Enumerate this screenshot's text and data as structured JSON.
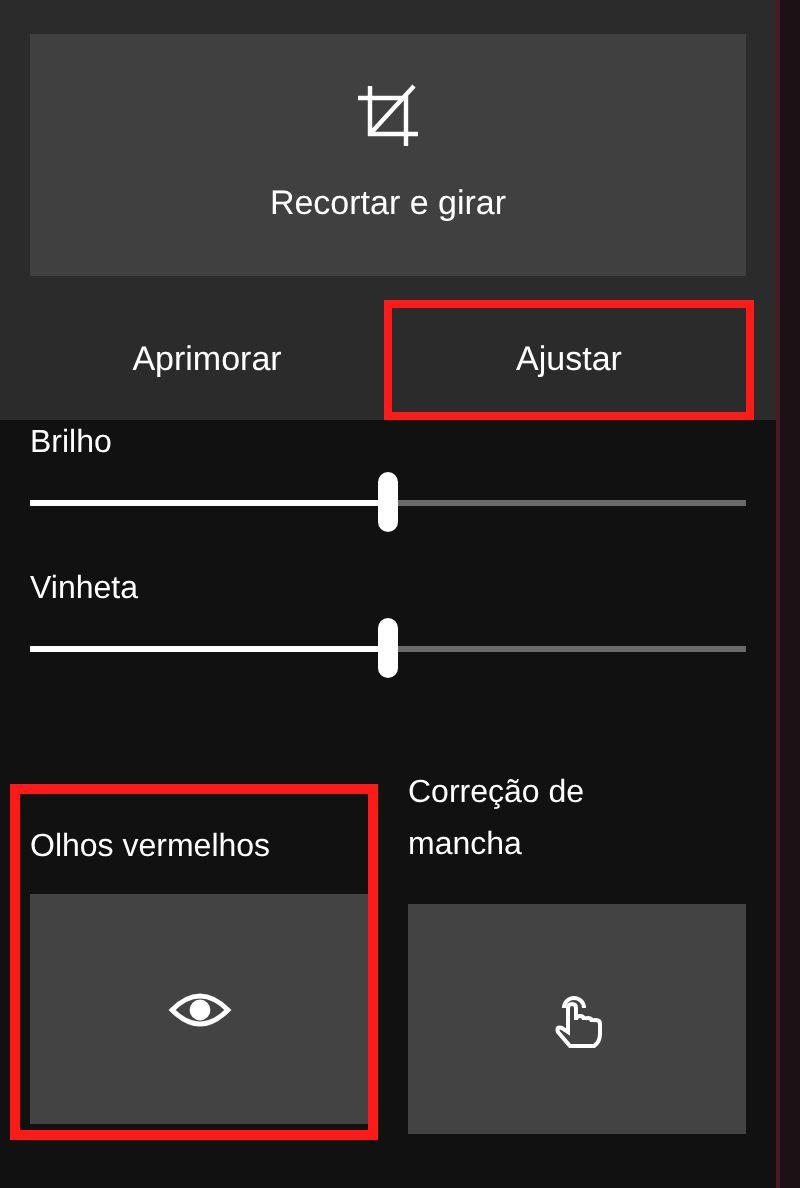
{
  "crop_button": {
    "label": "Recortar e girar"
  },
  "tabs": [
    {
      "label": "Aprimorar",
      "highlighted": false
    },
    {
      "label": "Ajustar",
      "highlighted": true
    }
  ],
  "sliders": [
    {
      "label": "Brilho",
      "level": 0.5
    },
    {
      "label": "Vinheta",
      "level": 0.5
    }
  ],
  "tools": [
    {
      "label": "Olhos vermelhos",
      "kind": "eye",
      "highlighted": true
    },
    {
      "label": "Correção de mancha",
      "kind": "touch",
      "highlighted": false
    }
  ]
}
